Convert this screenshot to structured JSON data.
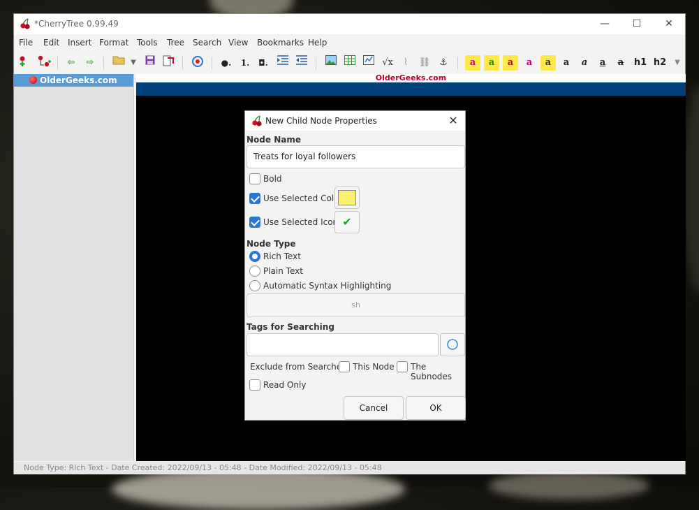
{
  "window": {
    "title": "*CherryTree 0.99.49",
    "minimize_glyph": "—",
    "maximize_glyph": "☐",
    "close_glyph": "✕"
  },
  "menu": [
    "File",
    "Edit",
    "Insert",
    "Format",
    "Tools",
    "Tree",
    "Search",
    "View",
    "Bookmarks",
    "Help"
  ],
  "toolbar": {
    "bullet_list": "●.",
    "numbered_list": "1.",
    "todo_list": "◘.",
    "bold": "a",
    "italic": "a",
    "underline": "a",
    "strikethrough": "a",
    "h1": "h1",
    "h2": "h2"
  },
  "tree": {
    "root_node": "OlderGeeks.com"
  },
  "editor": {
    "header_text": "OlderGeeks.com"
  },
  "status": {
    "text": "Node Type: Rich Text  -  Date Created: 2022/09/13 - 05:48  -  Date Modified: 2022/09/13 - 05:48"
  },
  "dialog": {
    "title": "New Child Node Properties",
    "close_glyph": "✕",
    "node_name_label": "Node Name",
    "node_name_value": "Treats for loyal followers",
    "bold_label": "Bold",
    "use_color_label": "Use Selected Color",
    "use_icon_label": "Use Selected Icon",
    "selected_color": "#fcf072",
    "icon_glyph": "✔",
    "node_type_label": "Node Type",
    "types": [
      "Rich Text",
      "Plain Text",
      "Automatic Syntax Highlighting"
    ],
    "syntax_value": "sh",
    "tags_label": "Tags for Searching",
    "tags_value": "",
    "exclude_label": "Exclude from Searches:",
    "this_node_label": "This Node",
    "subnodes_label": "The Subnodes",
    "read_only_label": "Read Only",
    "cancel_label": "Cancel",
    "ok_label": "OK"
  }
}
